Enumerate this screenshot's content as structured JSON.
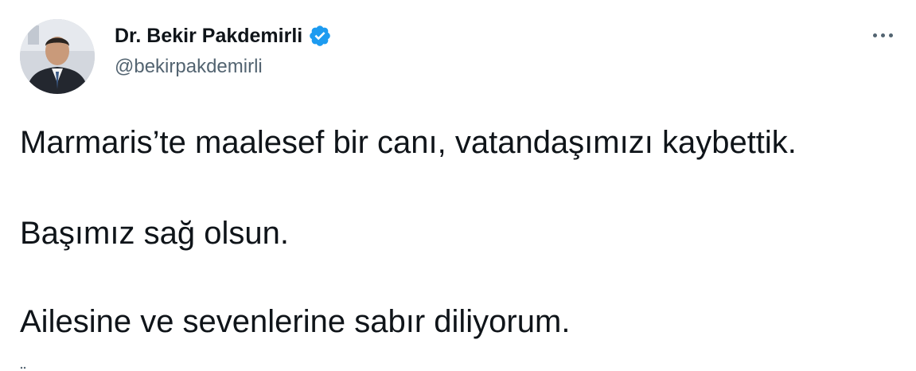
{
  "author": {
    "display_name": "Dr. Bekir Pakdemirli",
    "handle": "@bekirpakdemirli",
    "verified": true,
    "avatar_icon": "profile-photo"
  },
  "menu": {
    "icon": "more-horizontal-icon"
  },
  "tweet": {
    "lines": [
      "Marmaris’te maalesef bir canı, vatandaşımızı kaybettik.",
      "Başımız sağ olsun.",
      "Ailesine ve sevenlerine sabır diliyorum."
    ]
  },
  "colors": {
    "text": "#0f1419",
    "secondary": "#536471",
    "verified_blue": "#1d9bf0"
  }
}
